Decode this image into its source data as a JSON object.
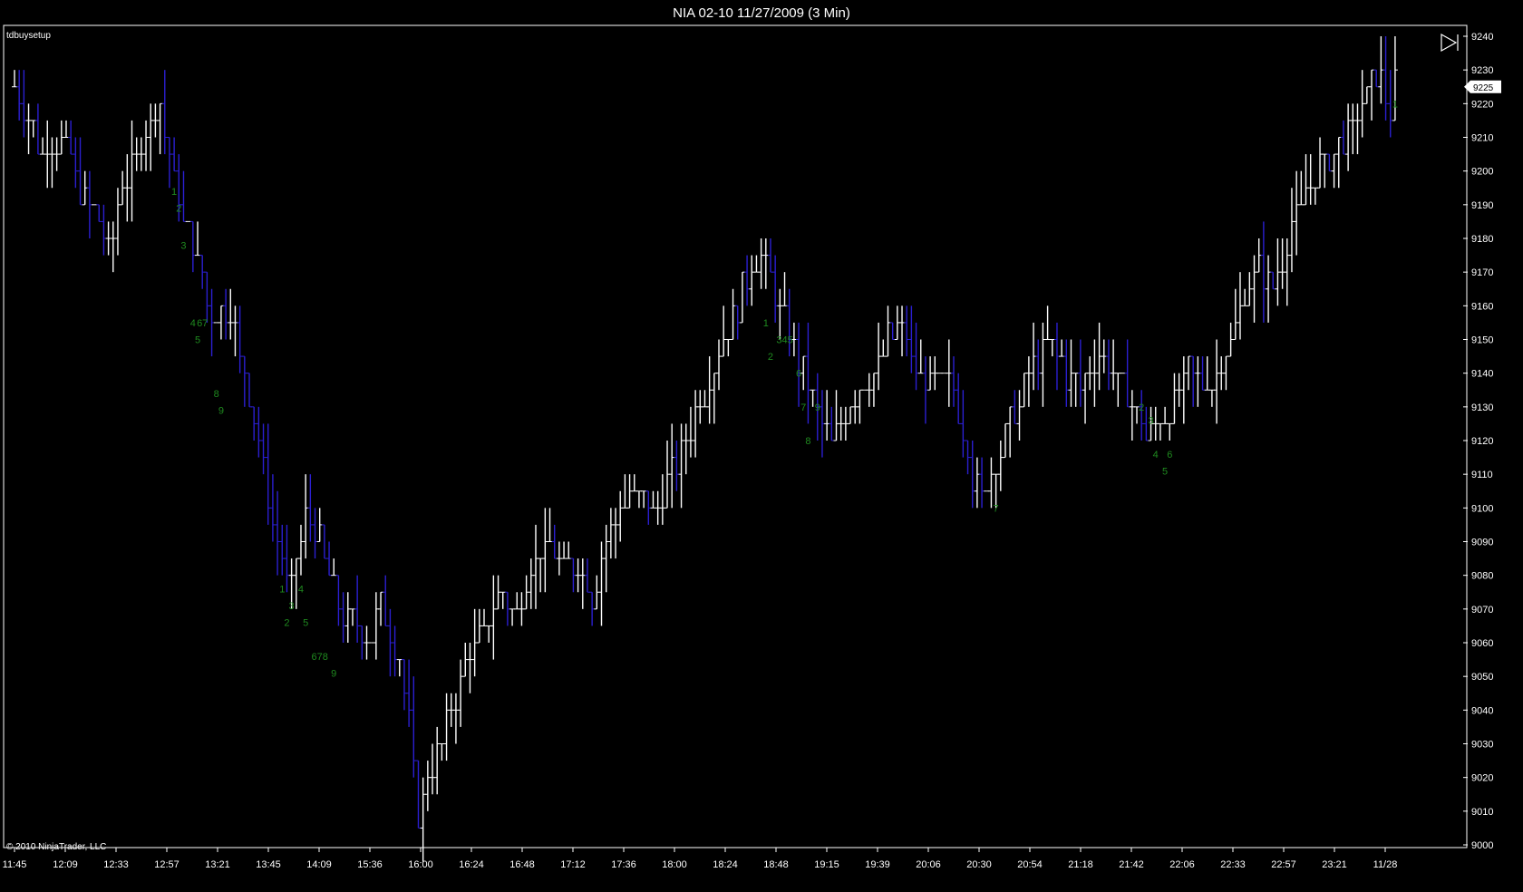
{
  "window": {
    "title": "NIA 02-10  11/27/2009 (3 Min)"
  },
  "indicator_label": "tdbuysetup",
  "copyright": "© 2010 NinjaTrader, LLC",
  "last_price_label": "9225",
  "colors": {
    "background": "#000000",
    "up_bar": "#ffffff",
    "down_bar": "#2b1fd1",
    "setup_count": "#1f8a1f",
    "axis": "#ffffff"
  },
  "chart_data": {
    "type": "bar",
    "style": "ohlc",
    "ylim": [
      9000,
      9240
    ],
    "y_ticks": [
      "9000",
      "9010",
      "9020",
      "9030",
      "9040",
      "9050",
      "9060",
      "9070",
      "9080",
      "9090",
      "9100",
      "9110",
      "9120",
      "9130",
      "9140",
      "9150",
      "9160",
      "9170",
      "9180",
      "9190",
      "9200",
      "9210",
      "9220",
      "9230",
      "9240"
    ],
    "x_ticks": [
      "11:45",
      "12:09",
      "12:33",
      "12:57",
      "13:21",
      "13:45",
      "14:09",
      "15:36",
      "16:00",
      "16:24",
      "16:48",
      "17:12",
      "17:36",
      "18:00",
      "18:24",
      "18:48",
      "19:15",
      "19:39",
      "20:06",
      "20:30",
      "20:54",
      "21:18",
      "21:42",
      "22:06",
      "22:33",
      "22:57",
      "23:21",
      "11/28"
    ],
    "path": [
      [
        0,
        9225
      ],
      [
        6,
        9205
      ],
      [
        10,
        9210
      ],
      [
        14,
        9195
      ],
      [
        18,
        9185
      ],
      [
        20,
        9175
      ],
      [
        23,
        9195
      ],
      [
        26,
        9205
      ],
      [
        29,
        9215
      ],
      [
        31,
        9220
      ],
      [
        33,
        9205
      ],
      [
        36,
        9185
      ],
      [
        40,
        9170
      ],
      [
        42,
        9155
      ],
      [
        46,
        9160
      ],
      [
        48,
        9145
      ],
      [
        50,
        9135
      ],
      [
        53,
        9110
      ],
      [
        56,
        9090
      ],
      [
        59,
        9075
      ],
      [
        62,
        9100
      ],
      [
        66,
        9085
      ],
      [
        69,
        9070
      ],
      [
        72,
        9065
      ],
      [
        75,
        9060
      ],
      [
        78,
        9070
      ],
      [
        82,
        9055
      ],
      [
        84,
        9035
      ],
      [
        86,
        9008
      ],
      [
        88,
        9020
      ],
      [
        92,
        9035
      ],
      [
        96,
        9055
      ],
      [
        99,
        9060
      ],
      [
        103,
        9075
      ],
      [
        107,
        9070
      ],
      [
        111,
        9085
      ],
      [
        114,
        9090
      ],
      [
        117,
        9080
      ],
      [
        120,
        9085
      ],
      [
        123,
        9075
      ],
      [
        126,
        9090
      ],
      [
        129,
        9100
      ],
      [
        132,
        9105
      ],
      [
        136,
        9100
      ],
      [
        140,
        9110
      ],
      [
        143,
        9120
      ],
      [
        147,
        9135
      ],
      [
        151,
        9150
      ],
      [
        155,
        9165
      ],
      [
        158,
        9175
      ],
      [
        160,
        9170
      ],
      [
        164,
        9155
      ],
      [
        168,
        9140
      ],
      [
        171,
        9130
      ],
      [
        174,
        9120
      ],
      [
        177,
        9130
      ],
      [
        180,
        9135
      ],
      [
        183,
        9140
      ],
      [
        186,
        9150
      ],
      [
        189,
        9155
      ],
      [
        192,
        9140
      ],
      [
        195,
        9135
      ],
      [
        198,
        9140
      ],
      [
        201,
        9130
      ],
      [
        204,
        9110
      ],
      [
        206,
        9105
      ],
      [
        209,
        9115
      ],
      [
        212,
        9125
      ],
      [
        215,
        9135
      ],
      [
        218,
        9145
      ],
      [
        221,
        9150
      ],
      [
        224,
        9140
      ],
      [
        227,
        9135
      ],
      [
        230,
        9145
      ],
      [
        233,
        9145
      ],
      [
        236,
        9135
      ],
      [
        239,
        9130
      ],
      [
        241,
        9120
      ],
      [
        244,
        9125
      ],
      [
        247,
        9130
      ],
      [
        250,
        9140
      ],
      [
        253,
        9135
      ],
      [
        256,
        9140
      ],
      [
        259,
        9150
      ],
      [
        262,
        9165
      ],
      [
        265,
        9170
      ],
      [
        268,
        9165
      ],
      [
        271,
        9180
      ],
      [
        274,
        9190
      ],
      [
        277,
        9200
      ],
      [
        280,
        9205
      ],
      [
        283,
        9210
      ],
      [
        286,
        9215
      ],
      [
        289,
        9225
      ],
      [
        291,
        9230
      ],
      [
        293,
        9215
      ],
      [
        294,
        9225
      ]
    ],
    "setup_counts": [
      {
        "text": "1",
        "bar": 34,
        "price": 9194
      },
      {
        "text": "2",
        "bar": 35,
        "price": 9189
      },
      {
        "text": "3",
        "bar": 36,
        "price": 9178
      },
      {
        "text": "4",
        "bar": 38,
        "price": 9155
      },
      {
        "text": "67",
        "bar": 40,
        "price": 9155
      },
      {
        "text": "5",
        "bar": 39,
        "price": 9150
      },
      {
        "text": "8",
        "bar": 43,
        "price": 9134
      },
      {
        "text": "9",
        "bar": 44,
        "price": 9129
      },
      {
        "text": "1",
        "bar": 57,
        "price": 9076
      },
      {
        "text": "4",
        "bar": 61,
        "price": 9076
      },
      {
        "text": "3",
        "bar": 59,
        "price": 9071
      },
      {
        "text": "2",
        "bar": 58,
        "price": 9066
      },
      {
        "text": "5",
        "bar": 62,
        "price": 9066
      },
      {
        "text": "678",
        "bar": 65,
        "price": 9056
      },
      {
        "text": "9",
        "bar": 68,
        "price": 9051
      },
      {
        "text": "1",
        "bar": 160,
        "price": 9155
      },
      {
        "text": "345",
        "bar": 164,
        "price": 9150
      },
      {
        "text": "2",
        "bar": 161,
        "price": 9145
      },
      {
        "text": "6",
        "bar": 167,
        "price": 9140
      },
      {
        "text": "7",
        "bar": 168,
        "price": 9130
      },
      {
        "text": "9",
        "bar": 171,
        "price": 9130
      },
      {
        "text": "8",
        "bar": 169,
        "price": 9120
      },
      {
        "text": "7",
        "bar": 209,
        "price": 9100
      },
      {
        "text": "2",
        "bar": 240,
        "price": 9130
      },
      {
        "text": "3",
        "bar": 242,
        "price": 9126
      },
      {
        "text": "4",
        "bar": 243,
        "price": 9116
      },
      {
        "text": "6",
        "bar": 246,
        "price": 9116
      },
      {
        "text": "5",
        "bar": 245,
        "price": 9111
      },
      {
        "text": "1",
        "bar": 294,
        "price": 9220
      }
    ]
  }
}
